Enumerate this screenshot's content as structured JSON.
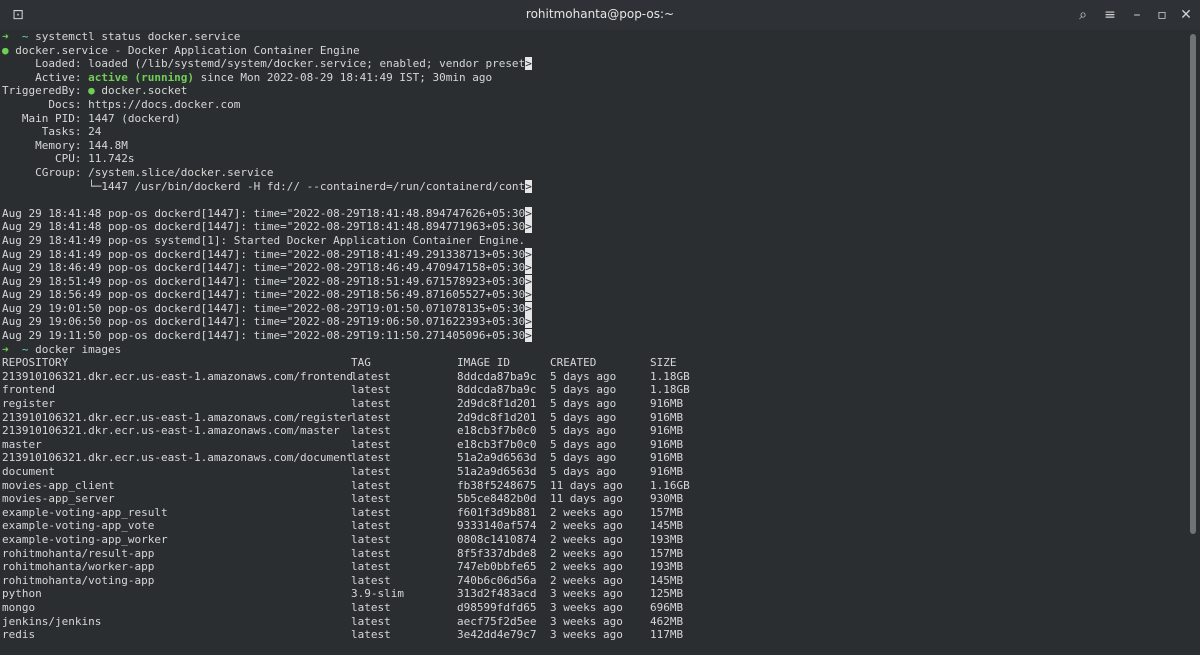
{
  "window": {
    "title": "rohitmohanta@pop-os:~",
    "icons": [
      "terminal-icon",
      "search-icon",
      "menu-icon",
      "minimize-icon",
      "maximize-icon",
      "close-icon"
    ]
  },
  "colors": {
    "background": "#2b2e30",
    "text": "#d6d6d6",
    "prompt_green": "#6fcf55",
    "prompt_cyan": "#5fd7d7",
    "active_green": "#6fcf55"
  },
  "prompt": {
    "arrow": "➜",
    "tilde": "~"
  },
  "commands": [
    "systemctl status docker.service",
    "docker images"
  ],
  "status": {
    "header_dot": "●",
    "header": "docker.service - Docker Application Container Engine",
    "loaded": "     Loaded: loaded (/lib/systemd/system/docker.service; enabled; vendor preset",
    "active_label": "     Active: ",
    "active_state": "active (running)",
    "active_rest": " since Mon 2022-08-29 18:41:49 IST; 30min ago",
    "triggered_label": "TriggeredBy: ",
    "triggered_dot": "●",
    "triggered_value": " docker.socket",
    "docs": "       Docs: https://docs.docker.com",
    "mainpid": "   Main PID: 1447 (dockerd)",
    "tasks": "      Tasks: 24",
    "memory": "     Memory: 144.8M",
    "cpu": "        CPU: 11.742s",
    "cgroup": "     CGroup: /system.slice/docker.service",
    "cgroup_child": "             └─1447 /usr/bin/dockerd -H fd:// --containerd=/run/containerd/cont",
    "truncation_marker": ">"
  },
  "logs": [
    {
      "text": "Aug 29 18:41:48 pop-os dockerd[1447]: time=\"2022-08-29T18:41:48.894747626+05:30",
      "truncated": true
    },
    {
      "text": "Aug 29 18:41:48 pop-os dockerd[1447]: time=\"2022-08-29T18:41:48.894771963+05:30",
      "truncated": true
    },
    {
      "text": "Aug 29 18:41:49 pop-os systemd[1]: Started Docker Application Container Engine.",
      "truncated": false
    },
    {
      "text": "Aug 29 18:41:49 pop-os dockerd[1447]: time=\"2022-08-29T18:41:49.291338713+05:30",
      "truncated": true
    },
    {
      "text": "Aug 29 18:46:49 pop-os dockerd[1447]: time=\"2022-08-29T18:46:49.470947158+05:30",
      "truncated": true
    },
    {
      "text": "Aug 29 18:51:49 pop-os dockerd[1447]: time=\"2022-08-29T18:51:49.671578923+05:30",
      "truncated": true
    },
    {
      "text": "Aug 29 18:56:49 pop-os dockerd[1447]: time=\"2022-08-29T18:56:49.871605527+05:30",
      "truncated": true
    },
    {
      "text": "Aug 29 19:01:50 pop-os dockerd[1447]: time=\"2022-08-29T19:01:50.071078135+05:30",
      "truncated": true
    },
    {
      "text": "Aug 29 19:06:50 pop-os dockerd[1447]: time=\"2022-08-29T19:06:50.071622393+05:30",
      "truncated": true
    },
    {
      "text": "Aug 29 19:11:50 pop-os dockerd[1447]: time=\"2022-08-29T19:11:50.271405096+05:30",
      "truncated": true
    }
  ],
  "images_table": {
    "headers": [
      "REPOSITORY",
      "TAG",
      "IMAGE ID",
      "CREATED",
      "SIZE"
    ],
    "rows": [
      [
        "213910106321.dkr.ecr.us-east-1.amazonaws.com/frontend",
        "latest",
        "8ddcda87ba9c",
        "5 days ago",
        "1.18GB"
      ],
      [
        "frontend",
        "latest",
        "8ddcda87ba9c",
        "5 days ago",
        "1.18GB"
      ],
      [
        "register",
        "latest",
        "2d9dc8f1d201",
        "5 days ago",
        "916MB"
      ],
      [
        "213910106321.dkr.ecr.us-east-1.amazonaws.com/register",
        "latest",
        "2d9dc8f1d201",
        "5 days ago",
        "916MB"
      ],
      [
        "213910106321.dkr.ecr.us-east-1.amazonaws.com/master",
        "latest",
        "e18cb3f7b0c0",
        "5 days ago",
        "916MB"
      ],
      [
        "master",
        "latest",
        "e18cb3f7b0c0",
        "5 days ago",
        "916MB"
      ],
      [
        "213910106321.dkr.ecr.us-east-1.amazonaws.com/document",
        "latest",
        "51a2a9d6563d",
        "5 days ago",
        "916MB"
      ],
      [
        "document",
        "latest",
        "51a2a9d6563d",
        "5 days ago",
        "916MB"
      ],
      [
        "movies-app_client",
        "latest",
        "fb38f5248675",
        "11 days ago",
        "1.16GB"
      ],
      [
        "movies-app_server",
        "latest",
        "5b5ce8482b0d",
        "11 days ago",
        "930MB"
      ],
      [
        "example-voting-app_result",
        "latest",
        "f601f3d9b881",
        "2 weeks ago",
        "157MB"
      ],
      [
        "example-voting-app_vote",
        "latest",
        "9333140af574",
        "2 weeks ago",
        "145MB"
      ],
      [
        "example-voting-app_worker",
        "latest",
        "0808c1410874",
        "2 weeks ago",
        "193MB"
      ],
      [
        "rohitmohanta/result-app",
        "latest",
        "8f5f337dbde8",
        "2 weeks ago",
        "157MB"
      ],
      [
        "rohitmohanta/worker-app",
        "latest",
        "747eb0bbfe65",
        "2 weeks ago",
        "193MB"
      ],
      [
        "rohitmohanta/voting-app",
        "latest",
        "740b6c06d56a",
        "2 weeks ago",
        "145MB"
      ],
      [
        "python",
        "3.9-slim",
        "313d2f483acd",
        "3 weeks ago",
        "125MB"
      ],
      [
        "mongo",
        "latest",
        "d98599fdfd65",
        "3 weeks ago",
        "696MB"
      ],
      [
        "jenkins/jenkins",
        "latest",
        "aecf75f2d5ee",
        "3 weeks ago",
        "462MB"
      ],
      [
        "redis",
        "latest",
        "3e42dd4e79c7",
        "3 weeks ago",
        "117MB"
      ]
    ]
  }
}
